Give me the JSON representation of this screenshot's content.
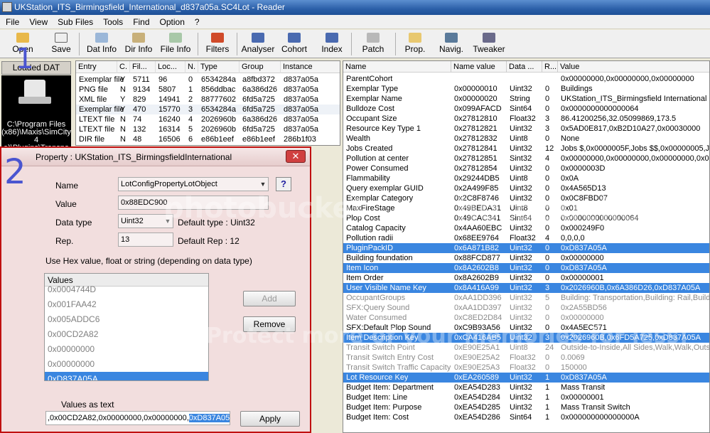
{
  "window_title": "UKStation_ITS_Birmingsfield_International_d837a05a.SC4Lot - Reader",
  "menu": [
    "File",
    "View",
    "Sub Files",
    "Tools",
    "Find",
    "Option",
    "?"
  ],
  "toolbar": [
    {
      "label": "Open",
      "icon": "folder-open-icon"
    },
    {
      "label": "Save",
      "icon": "save-icon"
    },
    {
      "label": "Dat Info",
      "icon": "dat-info-icon"
    },
    {
      "label": "Dir Info",
      "icon": "dir-info-icon"
    },
    {
      "label": "File Info",
      "icon": "file-info-icon"
    },
    {
      "label": "Filters",
      "icon": "filters-icon"
    },
    {
      "label": "Analyser",
      "icon": "analyser-icon"
    },
    {
      "label": "Cohort",
      "icon": "cohort-icon"
    },
    {
      "label": "Index",
      "icon": "index-icon"
    },
    {
      "label": "Patch",
      "icon": "patch-icon"
    },
    {
      "label": "Prop.",
      "icon": "prop-icon"
    },
    {
      "label": "Navig.",
      "icon": "navig-icon"
    },
    {
      "label": "Tweaker",
      "icon": "tweaker-icon"
    }
  ],
  "loaded_dat": {
    "header": "Loaded DAT",
    "path_lines": [
      "C:\\Program Files",
      "(x86)\\Maxis\\SimCity",
      "4",
      "e)\\Plugins\\Transpo"
    ]
  },
  "annotations": {
    "one": "1",
    "two": "2"
  },
  "file_list": {
    "headers": [
      "Entry",
      "C.",
      "Fil...",
      "Loc...",
      "N.",
      "Type",
      "Group",
      "Instance"
    ],
    "rows": [
      [
        "Exemplar file",
        "Y",
        "5711",
        "96",
        "0",
        "6534284a",
        "a8fbd372",
        "d837a05a"
      ],
      [
        "PNG file",
        "N",
        "9134",
        "5807",
        "1",
        "856ddbac",
        "6a386d26",
        "d837a05a"
      ],
      [
        "XML file",
        "Y",
        "829",
        "14941",
        "2",
        "88777602",
        "6fd5a725",
        "d837a05a"
      ],
      [
        "Exemplar file",
        "Y",
        "470",
        "15770",
        "3",
        "6534284a",
        "6fd5a725",
        "d837a05a"
      ],
      [
        "LTEXT file",
        "N",
        "74",
        "16240",
        "4",
        "2026960b",
        "6a386d26",
        "d837a05a"
      ],
      [
        "LTEXT file",
        "N",
        "132",
        "16314",
        "5",
        "2026960b",
        "6fd5a725",
        "d837a05a"
      ],
      [
        "DIR file",
        "N",
        "48",
        "16506",
        "6",
        "e86b1eef",
        "e86b1eef",
        "286b1f03"
      ]
    ]
  },
  "properties": {
    "headers": [
      "Name",
      "Name value",
      "Data ...",
      "R...",
      "Value"
    ],
    "rows": [
      [
        "ParentCohort",
        "",
        "",
        "",
        "0x00000000,0x00000000,0x00000000"
      ],
      [
        "Exemplar Type",
        "0x00000010",
        "Uint32",
        "0",
        "Buildings"
      ],
      [
        "Exemplar Name",
        "0x00000020",
        "String",
        "0",
        "UKStation_ITS_Birmingsfield International"
      ],
      [
        "Bulldoze Cost",
        "0x099AFACD",
        "Sint64",
        "0",
        "0x0000000000000064"
      ],
      [
        "Occupant Size",
        "0x27812810",
        "Float32",
        "3",
        "86.41200256,32.05099869,173.5"
      ],
      [
        "Resource Key Type 1",
        "0x27812821",
        "Uint32",
        "3",
        "0x5AD0E817,0xB2D10A27,0x00030000"
      ],
      [
        "Wealth",
        "0x27812832",
        "Uint8",
        "0",
        "None"
      ],
      [
        "Jobs Created",
        "0x27812841",
        "Uint32",
        "12",
        "Jobs $,0x0000005F,Jobs $$,0x00000005,Jol"
      ],
      [
        "Pollution at center",
        "0x27812851",
        "Sint32",
        "4",
        "0x00000000,0x00000000,0x00000000,0x000"
      ],
      [
        "Power Consumed",
        "0x27812854",
        "Uint32",
        "0",
        "0x0000003D"
      ],
      [
        "Flammability",
        "0x29244DB5",
        "Uint8",
        "0",
        "0x0A"
      ],
      [
        "Query exemplar GUID",
        "0x2A499F85",
        "Uint32",
        "0",
        "0x4A565D13"
      ],
      [
        "Exemplar Category",
        "0x2C8F8746",
        "Uint32",
        "0",
        "0x0C8FBD07"
      ],
      [
        "MaxFireStage",
        "0x49BEDA31",
        "Uint8",
        "0",
        "0x01"
      ],
      [
        "Plop Cost",
        "0x49CAC341",
        "Sint64",
        "0",
        "0x0000000000000064"
      ],
      [
        "Catalog Capacity",
        "0x4AA60EBC",
        "Uint32",
        "0",
        "0x000249F0"
      ],
      [
        "Pollution radii",
        "0x68EE9764",
        "Float32",
        "4",
        "0,0,0,0"
      ],
      [
        "PluginPackID",
        "0x6A871B82",
        "Uint32",
        "0",
        "0xD837A05A"
      ],
      [
        "Building foundation",
        "0x88FCD877",
        "Uint32",
        "0",
        "0x00000000"
      ],
      [
        "Item Icon",
        "0x8A2602B8",
        "Uint32",
        "0",
        "0xD837A05A"
      ],
      [
        "Item Order",
        "0x8A2602B9",
        "Uint32",
        "0",
        "0x00000001"
      ],
      [
        "User Visible Name Key",
        "0x8A416A99",
        "Uint32",
        "3",
        "0x2026960B,0x6A386D26,0xD837A05A"
      ],
      [
        "OccupantGroups",
        "0xAA1DD396",
        "Uint32",
        "5",
        "Building: Transportation,Building: Rail,Building"
      ],
      [
        "SFX:Query Sound",
        "0xAA1DD397",
        "Uint32",
        "0",
        "0x2A55BD56"
      ],
      [
        "Water Consumed",
        "0xC8ED2D84",
        "Uint32",
        "0",
        "0x00000000"
      ],
      [
        "SFX:Default Plop Sound",
        "0xC9B93A56",
        "Uint32",
        "0",
        "0x4A5EC571"
      ],
      [
        "Item Description Key",
        "0xCA416AB5",
        "Uint32",
        "3",
        "0x2026960B,0x6FD5A725,0xD837A05A"
      ],
      [
        "Transit Switch Point",
        "0xE90E25A1",
        "Uint8",
        "24",
        "Outside-to-Inside,All Sides,Walk,Walk,Outsid"
      ],
      [
        "Transit Switch Entry Cost",
        "0xE90E25A2",
        "Float32",
        "0",
        "0.0069"
      ],
      [
        "Transit Switch Traffic Capacity",
        "0xE90E25A3",
        "Float32",
        "0",
        "150000"
      ],
      [
        "Lot Resource Key",
        "0xEA260589",
        "Uint32",
        "1",
        "0xD837A05A"
      ],
      [
        "Budget Item: Department",
        "0xEA54D283",
        "Uint32",
        "1",
        "Mass Transit"
      ],
      [
        "Budget Item: Line",
        "0xEA54D284",
        "Uint32",
        "1",
        "0x00000001"
      ],
      [
        "Budget Item: Purpose",
        "0xEA54D285",
        "Uint32",
        "1",
        "Mass Transit Switch"
      ],
      [
        "Budget Item: Cost",
        "0xEA54D286",
        "Sint64",
        "1",
        "0x000000000000000A"
      ]
    ],
    "selected_rows": [
      17,
      19,
      21,
      26,
      30
    ],
    "grey_rows": [
      22,
      23,
      24,
      27,
      28,
      29
    ]
  },
  "dialog": {
    "title": "Property : UKStation_ITS_BirmingsfieldInternational",
    "name_label": "Name",
    "name_value": "LotConfigPropertyLotObject",
    "help_label": "?",
    "value_label": "Value",
    "value_value": "0x88EDC900",
    "datatype_label": "Data type",
    "datatype_value": "Uint32",
    "default_type_label": "Default type :",
    "default_type_value": "Uint32",
    "rep_label": "Rep.",
    "rep_value": "13",
    "default_rep_label": "Default Rep :",
    "default_rep_value": "12",
    "hint": "Use Hex value, float or string (depending on data type)",
    "values_header": "Values",
    "values": [
      "0x0004744D",
      "0x001FAA42",
      "0x005ADDC6",
      "0x00CD2A82",
      "0x00000000",
      "0x00000000",
      "0xD837A05A"
    ],
    "values_selected": 6,
    "add_label": "Add",
    "remove_label": "Remove",
    "values_as_text_label": "Values as text",
    "values_as_text_plain": ",0x00CD2A82,0x00000000,0x00000000,",
    "values_as_text_selected": "0xD837A05A",
    "apply_label": "Apply",
    "close_label": "✕"
  },
  "watermark": [
    "photobucket",
    "Protect more of your memories for less!",
    "photobucket"
  ]
}
